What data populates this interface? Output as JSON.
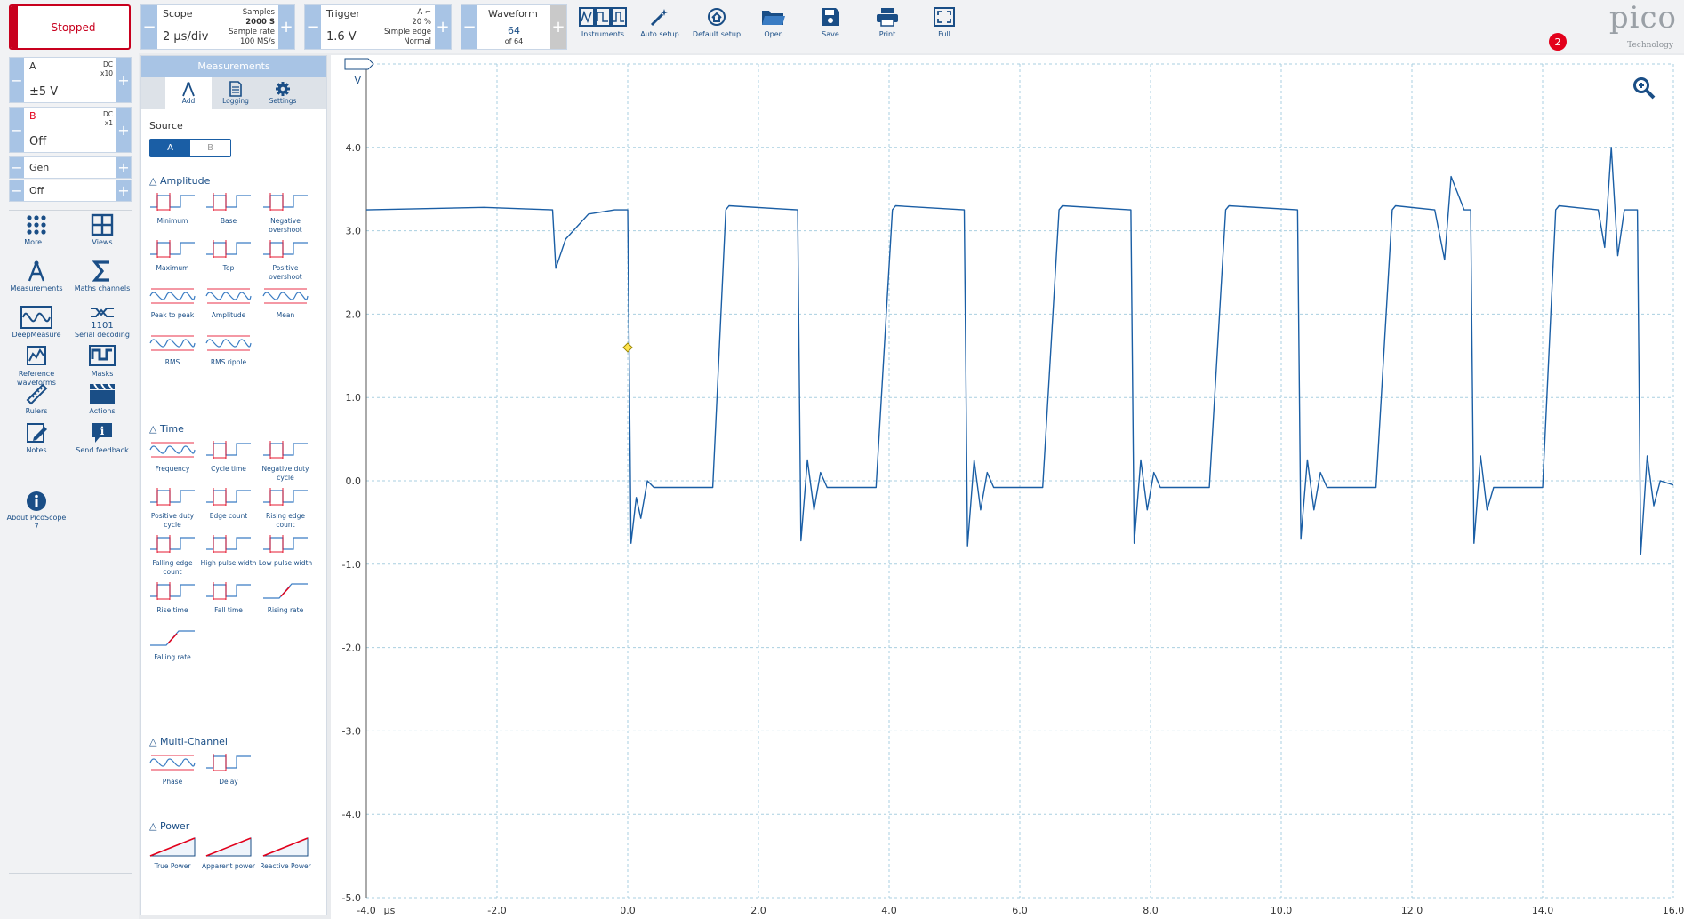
{
  "toolbar": {
    "run_button_label": "Stopped",
    "scope": {
      "title": "Scope",
      "timebase": "2 µs/div",
      "samples_label": "Samples",
      "samples_value": "2000 S",
      "rate_label": "Sample rate",
      "rate_value": "100 MS/s"
    },
    "trigger": {
      "title": "Trigger",
      "level": "1.6 V",
      "channel": "A",
      "percent": "20 %",
      "type": "Simple edge",
      "mode": "Normal"
    },
    "waveform": {
      "title": "Waveform",
      "current": "64",
      "total": "of 64"
    },
    "buttons": [
      {
        "id": "instruments",
        "label": "Instruments"
      },
      {
        "id": "auto-setup",
        "label": "Auto setup"
      },
      {
        "id": "default-setup",
        "label": "Default setup"
      },
      {
        "id": "open",
        "label": "Open"
      },
      {
        "id": "save",
        "label": "Save"
      },
      {
        "id": "print",
        "label": "Print"
      },
      {
        "id": "full",
        "label": "Full"
      }
    ],
    "logo_word": "pico",
    "logo_tag": "Technology",
    "notification_count": "2"
  },
  "channels": [
    {
      "name": "A",
      "coupling": "DC",
      "probe": "x10",
      "range": "±5 V",
      "color": "#1a5ea5"
    },
    {
      "name": "B",
      "coupling": "DC",
      "probe": "x1",
      "range": "Off",
      "color": "#e3001b"
    },
    {
      "name": "Gen",
      "range": "Off"
    }
  ],
  "tools": [
    {
      "id": "more",
      "label": "More..."
    },
    {
      "id": "views",
      "label": "Views"
    },
    {
      "id": "measurements",
      "label": "Measurements"
    },
    {
      "id": "maths",
      "label": "Maths channels"
    },
    {
      "id": "deepmeasure",
      "label": "DeepMeasure"
    },
    {
      "id": "serial",
      "label": "Serial decoding"
    },
    {
      "id": "reference",
      "label": "Reference waveforms"
    },
    {
      "id": "masks",
      "label": "Masks"
    },
    {
      "id": "rulers",
      "label": "Rulers"
    },
    {
      "id": "actions",
      "label": "Actions"
    },
    {
      "id": "notes",
      "label": "Notes"
    },
    {
      "id": "feedback",
      "label": "Send feedback"
    },
    {
      "id": "about",
      "label": "About PicoScope 7"
    }
  ],
  "measurements": {
    "title": "Measurements",
    "tabs": [
      "Add",
      "Logging",
      "Settings"
    ],
    "source_label": "Source",
    "source_options": [
      "A",
      "B"
    ],
    "sections": [
      {
        "title": "Amplitude",
        "items": [
          "Minimum",
          "Base",
          "Negative overshoot",
          "Maximum",
          "Top",
          "Positive overshoot",
          "Peak to peak",
          "Amplitude",
          "Mean",
          "RMS",
          "RMS ripple"
        ]
      },
      {
        "title": "Time",
        "items": [
          "Frequency",
          "Cycle time",
          "Negative duty cycle",
          "Positive duty cycle",
          "Edge count",
          "Rising edge count",
          "Falling edge count",
          "High pulse width",
          "Low pulse width",
          "Rise time",
          "Fall time",
          "Rising rate",
          "Falling rate"
        ]
      },
      {
        "title": "Multi-Channel",
        "items": [
          "Phase",
          "Delay"
        ]
      },
      {
        "title": "Power",
        "items": [
          "True Power",
          "Apparent power",
          "Reactive Power"
        ]
      }
    ]
  },
  "chart_data": {
    "type": "line",
    "x_unit": "µs",
    "y_unit": "V",
    "xlim": [
      -4.0,
      16.0
    ],
    "ylim": [
      -5.0,
      5.0
    ],
    "x_ticks": [
      "-4.0",
      "-2.0",
      "0.0",
      "2.0",
      "4.0",
      "6.0",
      "8.0",
      "10.0",
      "12.0",
      "14.0",
      "16.0"
    ],
    "y_ticks": [
      "5.0",
      "4.0",
      "3.0",
      "2.0",
      "1.0",
      "0.0",
      "-1.0",
      "-2.0",
      "-3.0",
      "-4.0",
      "-5.0"
    ],
    "grid": true,
    "trigger_marker": {
      "x": 0.0,
      "y": 1.6
    },
    "series": [
      {
        "color": "#1a5ea5",
        "x": [
          -4.0,
          -2.2,
          -1.15,
          -1.1,
          -0.95,
          -0.6,
          -0.2,
          0.0,
          0.05,
          0.13,
          0.2,
          0.3,
          0.4,
          1.3,
          1.5,
          1.55,
          2.6,
          2.65,
          2.75,
          2.85,
          2.95,
          3.05,
          3.8,
          4.05,
          4.1,
          5.15,
          5.2,
          5.3,
          5.4,
          5.5,
          5.6,
          6.35,
          6.6,
          6.65,
          7.7,
          7.75,
          7.85,
          7.95,
          8.05,
          8.15,
          8.9,
          9.15,
          9.2,
          10.25,
          10.3,
          10.4,
          10.5,
          10.6,
          10.7,
          11.45,
          11.7,
          11.75,
          12.35,
          12.5,
          12.6,
          12.8,
          12.9,
          12.95,
          13.05,
          13.15,
          13.25,
          14.0,
          14.2,
          14.25,
          14.85,
          14.95,
          15.05,
          15.15,
          15.25,
          15.45,
          15.5,
          15.6,
          15.7,
          15.8,
          16.0
        ],
        "y": [
          3.25,
          3.28,
          3.25,
          2.55,
          2.9,
          3.2,
          3.25,
          3.25,
          -0.75,
          -0.2,
          -0.45,
          0.0,
          -0.08,
          -0.08,
          3.25,
          3.3,
          3.25,
          -0.72,
          0.25,
          -0.35,
          0.1,
          -0.08,
          -0.08,
          3.25,
          3.3,
          3.25,
          -0.78,
          0.25,
          -0.35,
          0.1,
          -0.08,
          -0.08,
          3.25,
          3.3,
          3.25,
          -0.75,
          0.25,
          -0.35,
          0.1,
          -0.08,
          -0.08,
          3.25,
          3.3,
          3.25,
          -0.7,
          0.25,
          -0.35,
          0.1,
          -0.08,
          -0.08,
          3.25,
          3.3,
          3.25,
          2.65,
          3.65,
          3.25,
          3.25,
          -0.75,
          0.3,
          -0.35,
          -0.08,
          -0.08,
          3.25,
          3.3,
          3.25,
          2.8,
          4.0,
          2.7,
          3.25,
          3.25,
          -0.88,
          0.3,
          -0.3,
          0.0,
          -0.05
        ]
      }
    ]
  }
}
